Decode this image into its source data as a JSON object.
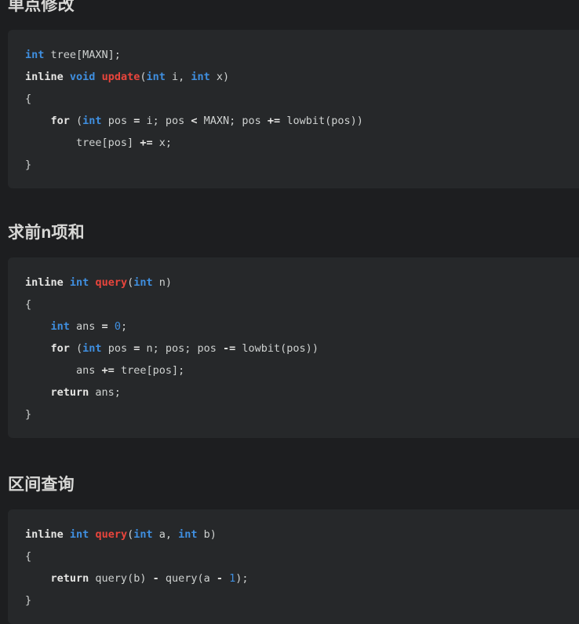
{
  "page": {
    "background_color": "#1d1e20",
    "code_background_color": "#26282a",
    "text_color": "#cfd2d1",
    "language": "cpp"
  },
  "theme": {
    "type_color": "#3f8fe0",
    "keyword_color": "#e6e6e4",
    "function_color": "#e8453c",
    "number_color": "#3f8fe0",
    "plain_color": "#cfd2d1",
    "heading_color": "#d8d8d6"
  },
  "sections": [
    {
      "heading": "单点修改",
      "code_lines": [
        [
          {
            "t": "int",
            "c": "type"
          },
          {
            "t": " tree[MAXN];",
            "c": "plain"
          }
        ],
        [
          {
            "t": "inline",
            "c": "keyword"
          },
          {
            "t": " ",
            "c": "plain"
          },
          {
            "t": "void",
            "c": "type"
          },
          {
            "t": " ",
            "c": "plain"
          },
          {
            "t": "update",
            "c": "func"
          },
          {
            "t": "(",
            "c": "plain"
          },
          {
            "t": "int",
            "c": "type"
          },
          {
            "t": " i, ",
            "c": "plain"
          },
          {
            "t": "int",
            "c": "type"
          },
          {
            "t": " x)",
            "c": "plain"
          }
        ],
        [
          {
            "t": "{",
            "c": "plain"
          }
        ],
        [
          {
            "t": "    ",
            "c": "plain"
          },
          {
            "t": "for",
            "c": "keyword"
          },
          {
            "t": " (",
            "c": "plain"
          },
          {
            "t": "int",
            "c": "type"
          },
          {
            "t": " pos ",
            "c": "plain"
          },
          {
            "t": "=",
            "c": "op"
          },
          {
            "t": " i; pos ",
            "c": "plain"
          },
          {
            "t": "<",
            "c": "op"
          },
          {
            "t": " MAXN; pos ",
            "c": "plain"
          },
          {
            "t": "+=",
            "c": "op"
          },
          {
            "t": " lowbit(pos))",
            "c": "plain"
          }
        ],
        [
          {
            "t": "        tree[pos] ",
            "c": "plain"
          },
          {
            "t": "+=",
            "c": "op"
          },
          {
            "t": " x;",
            "c": "plain"
          }
        ],
        [
          {
            "t": "}",
            "c": "plain"
          }
        ]
      ]
    },
    {
      "heading": "求前n项和",
      "code_lines": [
        [
          {
            "t": "inline",
            "c": "keyword"
          },
          {
            "t": " ",
            "c": "plain"
          },
          {
            "t": "int",
            "c": "type"
          },
          {
            "t": " ",
            "c": "plain"
          },
          {
            "t": "query",
            "c": "func"
          },
          {
            "t": "(",
            "c": "plain"
          },
          {
            "t": "int",
            "c": "type"
          },
          {
            "t": " n)",
            "c": "plain"
          }
        ],
        [
          {
            "t": "{",
            "c": "plain"
          }
        ],
        [
          {
            "t": "    ",
            "c": "plain"
          },
          {
            "t": "int",
            "c": "type"
          },
          {
            "t": " ans ",
            "c": "plain"
          },
          {
            "t": "=",
            "c": "op"
          },
          {
            "t": " ",
            "c": "plain"
          },
          {
            "t": "0",
            "c": "number"
          },
          {
            "t": ";",
            "c": "plain"
          }
        ],
        [
          {
            "t": "    ",
            "c": "plain"
          },
          {
            "t": "for",
            "c": "keyword"
          },
          {
            "t": " (",
            "c": "plain"
          },
          {
            "t": "int",
            "c": "type"
          },
          {
            "t": " pos ",
            "c": "plain"
          },
          {
            "t": "=",
            "c": "op"
          },
          {
            "t": " n; pos; pos ",
            "c": "plain"
          },
          {
            "t": "-=",
            "c": "op"
          },
          {
            "t": " lowbit(pos))",
            "c": "plain"
          }
        ],
        [
          {
            "t": "        ans ",
            "c": "plain"
          },
          {
            "t": "+=",
            "c": "op"
          },
          {
            "t": " tree[pos];",
            "c": "plain"
          }
        ],
        [
          {
            "t": "    ",
            "c": "plain"
          },
          {
            "t": "return",
            "c": "keyword"
          },
          {
            "t": " ans;",
            "c": "plain"
          }
        ],
        [
          {
            "t": "}",
            "c": "plain"
          }
        ]
      ]
    },
    {
      "heading": "区间查询",
      "code_lines": [
        [
          {
            "t": "inline",
            "c": "keyword"
          },
          {
            "t": " ",
            "c": "plain"
          },
          {
            "t": "int",
            "c": "type"
          },
          {
            "t": " ",
            "c": "plain"
          },
          {
            "t": "query",
            "c": "func"
          },
          {
            "t": "(",
            "c": "plain"
          },
          {
            "t": "int",
            "c": "type"
          },
          {
            "t": " a, ",
            "c": "plain"
          },
          {
            "t": "int",
            "c": "type"
          },
          {
            "t": " b)",
            "c": "plain"
          }
        ],
        [
          {
            "t": "{",
            "c": "plain"
          }
        ],
        [
          {
            "t": "    ",
            "c": "plain"
          },
          {
            "t": "return",
            "c": "keyword"
          },
          {
            "t": " query(b) ",
            "c": "plain"
          },
          {
            "t": "-",
            "c": "op"
          },
          {
            "t": " query(a ",
            "c": "plain"
          },
          {
            "t": "-",
            "c": "op"
          },
          {
            "t": " ",
            "c": "plain"
          },
          {
            "t": "1",
            "c": "number"
          },
          {
            "t": ");",
            "c": "plain"
          }
        ],
        [
          {
            "t": "}",
            "c": "plain"
          }
        ]
      ]
    }
  ]
}
